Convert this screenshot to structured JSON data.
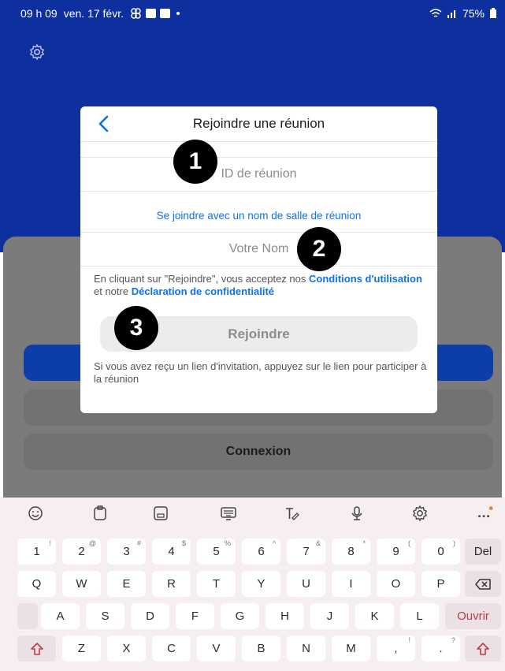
{
  "status_bar": {
    "time": "09 h 09",
    "date": "ven. 17 févr.",
    "battery": "75%"
  },
  "background": {
    "connexion_label": "Connexion"
  },
  "dialog": {
    "title": "Rejoindre une réunion",
    "meeting_id_placeholder": "ID de réunion",
    "room_name_link": "Se joindre avec un nom de salle de réunion",
    "name_placeholder": "Votre Nom",
    "terms_prefix": "En cliquant sur \"Rejoindre\", vous acceptez nos ",
    "terms_link": "Conditions d'utilisation",
    "terms_middle": " et notre ",
    "privacy_link": "Déclaration de confidentialité",
    "join_label": "Rejoindre",
    "invite_text": "Si vous avez reçu un lien d'invitation, appuyez sur le lien pour participer à la réunion"
  },
  "markers": [
    "1",
    "2",
    "3"
  ],
  "keyboard": {
    "number_row": [
      {
        "k": "1",
        "s": "!"
      },
      {
        "k": "2",
        "s": "@"
      },
      {
        "k": "3",
        "s": "#"
      },
      {
        "k": "4",
        "s": "$"
      },
      {
        "k": "5",
        "s": "%"
      },
      {
        "k": "6",
        "s": "^"
      },
      {
        "k": "7",
        "s": "&"
      },
      {
        "k": "8",
        "s": "*"
      },
      {
        "k": "9",
        "s": "("
      },
      {
        "k": "0",
        "s": ")"
      }
    ],
    "del_label": "Del",
    "row1": [
      "Q",
      "W",
      "E",
      "R",
      "T",
      "Y",
      "U",
      "I",
      "O",
      "P"
    ],
    "row2": [
      "A",
      "S",
      "D",
      "F",
      "G",
      "H",
      "J",
      "K",
      "L"
    ],
    "ouvrir_label": "Ouvrir",
    "row3": [
      "Z",
      "X",
      "C",
      "V",
      "B",
      "N",
      "M"
    ],
    "comma": {
      "k": ",",
      "s": "!"
    },
    "period": {
      "k": ".",
      "s": "?"
    }
  },
  "colors": {
    "header_blue": "#0e2f9e",
    "link_blue": "#0e72ed",
    "accent_red": "#c23a4a"
  }
}
